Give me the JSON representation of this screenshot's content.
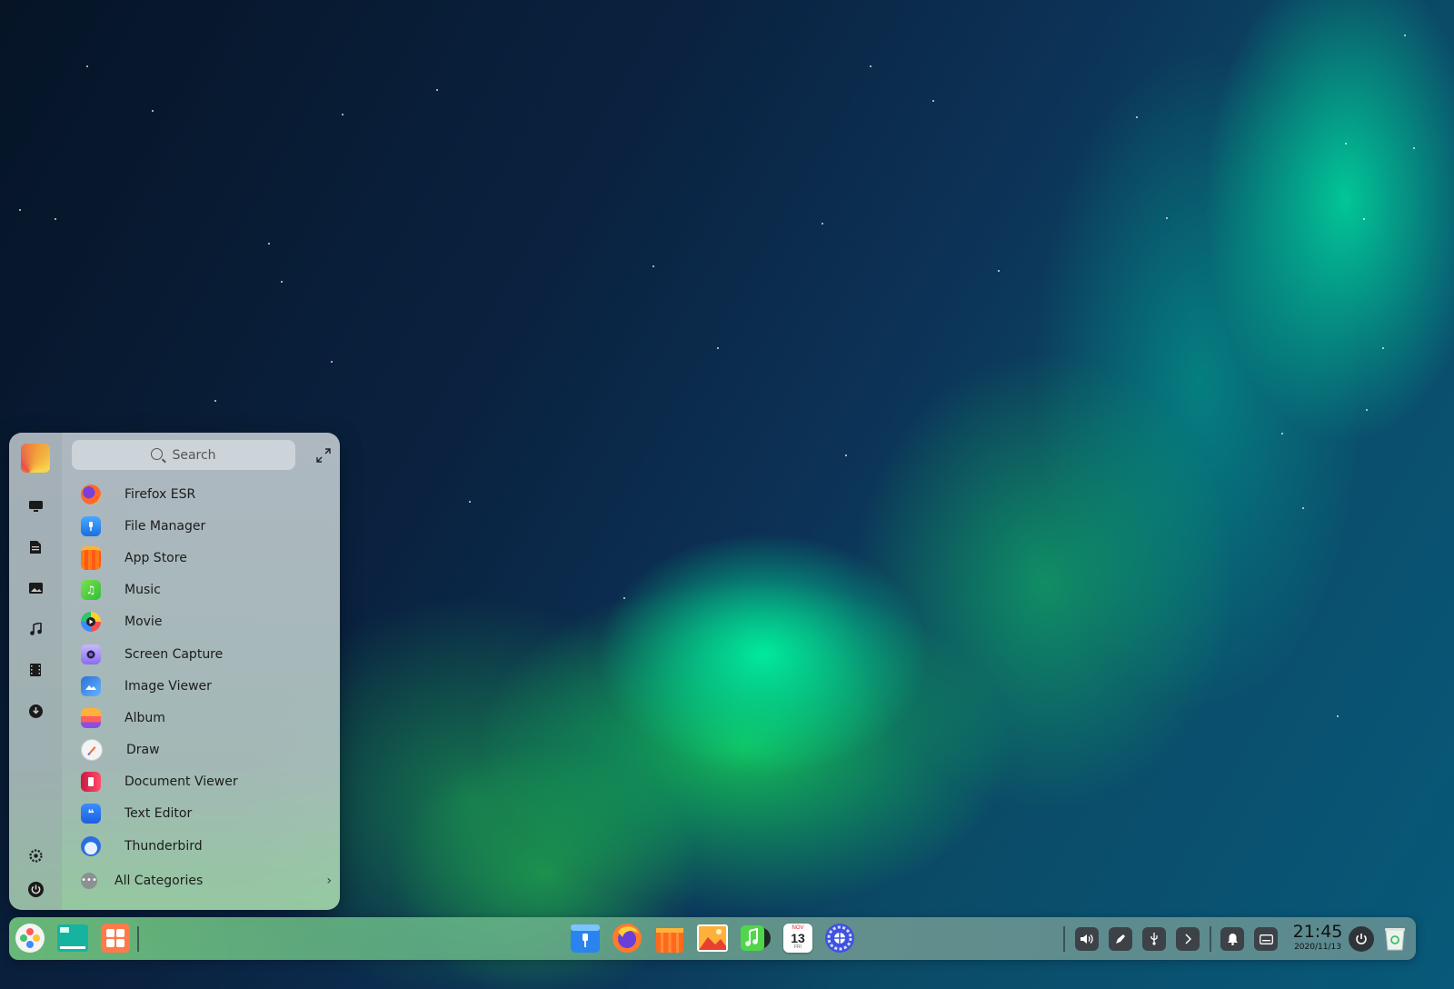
{
  "launcher": {
    "search": {
      "placeholder": "Search"
    },
    "sidebar": {
      "icons": [
        "monitor-icon",
        "document-icon",
        "picture-icon",
        "music-icon",
        "film-icon",
        "download-icon",
        "settings-icon",
        "power-icon"
      ]
    },
    "apps": [
      {
        "label": "Firefox ESR",
        "icon": "firefox-icon"
      },
      {
        "label": "File Manager",
        "icon": "file-manager-icon"
      },
      {
        "label": "App Store",
        "icon": "app-store-icon"
      },
      {
        "label": "Music",
        "icon": "music-app-icon"
      },
      {
        "label": "Movie",
        "icon": "movie-icon"
      },
      {
        "label": "Screen Capture",
        "icon": "screen-capture-icon"
      },
      {
        "label": "Image Viewer",
        "icon": "image-viewer-icon"
      },
      {
        "label": "Album",
        "icon": "album-icon"
      },
      {
        "label": "Draw",
        "icon": "draw-icon"
      },
      {
        "label": "Document Viewer",
        "icon": "document-viewer-icon"
      },
      {
        "label": "Text Editor",
        "icon": "text-editor-icon"
      },
      {
        "label": "Thunderbird",
        "icon": "thunderbird-icon"
      }
    ],
    "all_categories_label": "All Categories"
  },
  "dock": {
    "left": [
      "launcher-icon",
      "multitasking-icon",
      "app-grid-icon"
    ],
    "apps": [
      "file-manager-icon",
      "firefox-icon",
      "app-store-icon",
      "album-icon",
      "music-app-icon",
      "calendar-icon",
      "control-center-icon"
    ],
    "calendar": {
      "month": "NOV",
      "day": "13",
      "weekday": "FRI"
    },
    "tray": [
      "volume-icon",
      "pen-icon",
      "usb-icon",
      "chevron-right-icon",
      "notification-bell-icon",
      "keyboard-icon"
    ],
    "clock": {
      "time": "21:45",
      "date": "2020/11/13"
    },
    "right": [
      "power-icon",
      "trash-icon"
    ]
  },
  "colors": {
    "launcher_bg": "#b9c3cb",
    "dock_accent": "#6ccf7f",
    "wallpaper_aurora": "#14d25a"
  }
}
